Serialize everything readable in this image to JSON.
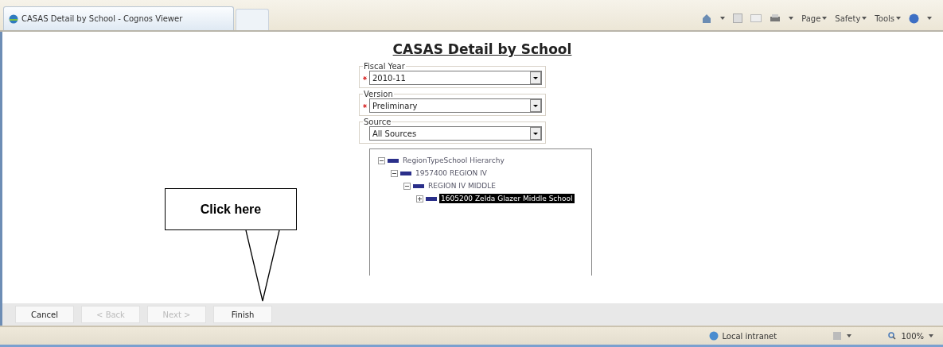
{
  "browser_tab": {
    "title": "CASAS Detail by School - Cognos Viewer"
  },
  "toolbar": {
    "menus": [
      "Page",
      "Safety",
      "Tools"
    ]
  },
  "report": {
    "title": "CASAS Detail by School",
    "prompts": [
      {
        "label": "Fiscal Year",
        "value": "2010-11",
        "required": true
      },
      {
        "label": "Version",
        "value": "Preliminary",
        "required": true
      },
      {
        "label": "Source",
        "value": "All Sources",
        "required": false
      }
    ],
    "tree": [
      {
        "label": "RegionTypeSchool Hierarchy",
        "expanded": true,
        "selected": false,
        "children": [
          {
            "label": "1957400 REGION IV",
            "expanded": true,
            "selected": false,
            "children": [
              {
                "label": "REGION IV MIDDLE",
                "expanded": true,
                "selected": false,
                "children": [
                  {
                    "label": "1605200 Zelda Glazer Middle School",
                    "expanded": false,
                    "selected": true
                  }
                ]
              }
            ]
          }
        ]
      }
    ]
  },
  "callout": {
    "text": "Click here"
  },
  "buttons": [
    {
      "label": "Cancel",
      "disabled": false
    },
    {
      "label": "< Back",
      "disabled": true
    },
    {
      "label": "Next >",
      "disabled": true
    },
    {
      "label": "Finish",
      "disabled": false
    }
  ],
  "status_bar": {
    "zone": "Local intranet",
    "zoom": "100%"
  }
}
